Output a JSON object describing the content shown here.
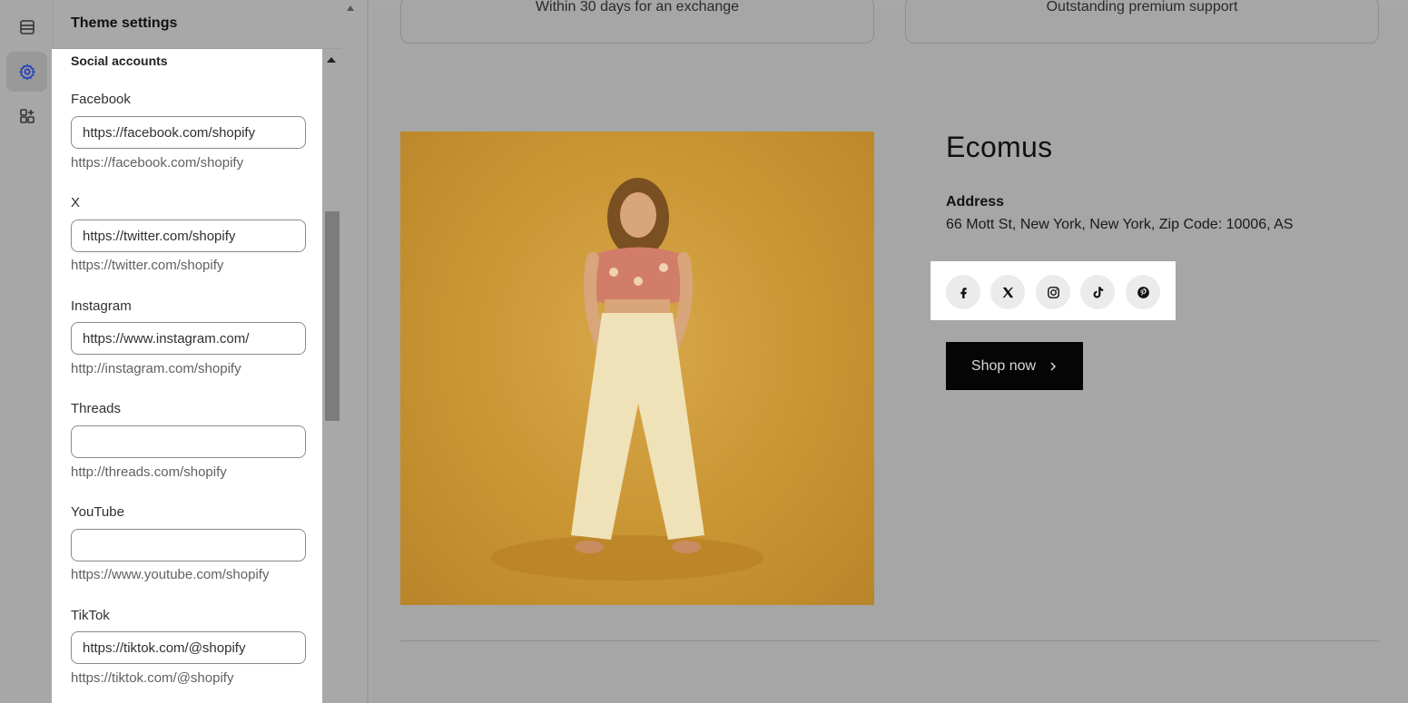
{
  "sidebar_rail": {
    "items": [
      {
        "icon": "sections-icon",
        "active": false
      },
      {
        "icon": "gear-icon",
        "active": true
      },
      {
        "icon": "apps-icon",
        "active": false
      }
    ]
  },
  "panel": {
    "title": "Theme settings",
    "section_title": "Social accounts",
    "fields": [
      {
        "label": "Facebook",
        "value": "https://facebook.com/shopify",
        "hint": "https://facebook.com/shopify"
      },
      {
        "label": "X",
        "value": "https://twitter.com/shopify",
        "hint": "https://twitter.com/shopify"
      },
      {
        "label": "Instagram",
        "value": "https://www.instagram.com/",
        "hint": "http://instagram.com/shopify"
      },
      {
        "label": "Threads",
        "value": "",
        "hint": "http://threads.com/shopify"
      },
      {
        "label": "YouTube",
        "value": "",
        "hint": "https://www.youtube.com/shopify"
      },
      {
        "label": "TikTok",
        "value": "https://tiktok.com/@shopify",
        "hint": "https://tiktok.com/@shopify"
      }
    ]
  },
  "preview": {
    "promos": [
      "Within 30 days for an exchange",
      "Outstanding premium support"
    ],
    "brand": "Ecomus",
    "address_label": "Address",
    "address_value": "66 Mott St, New York, New York, Zip Code: 10006, AS",
    "social_icons": [
      "facebook-icon",
      "x-icon",
      "instagram-icon",
      "tiktok-icon",
      "pinterest-icon"
    ],
    "cta_label": "Shop now"
  },
  "colors": {
    "overlay_gray": "#a8a8a8",
    "highlight_white": "#ffffff",
    "cta_bg": "#050505",
    "accent_blue": "#1f3fbf"
  }
}
